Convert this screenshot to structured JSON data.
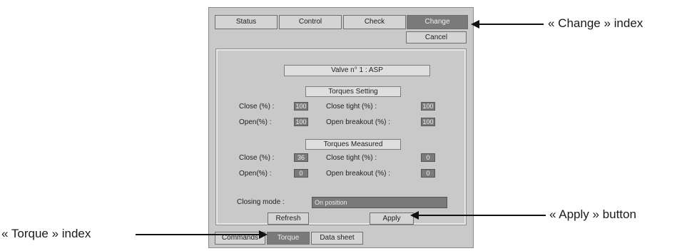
{
  "tabs": [
    {
      "label": "Status",
      "active": false
    },
    {
      "label": "Control",
      "active": false
    },
    {
      "label": "Check",
      "active": false
    },
    {
      "label": "Change",
      "active": true
    }
  ],
  "cancel_label": "Cancel",
  "valve_title": "Valve n° 1 : ASP",
  "torques_setting": {
    "title": "Torques Setting",
    "close_label": "Close (%) :",
    "close_value": "100",
    "close_tight_label": "Close tight (%) :",
    "close_tight_value": "100",
    "open_label": "Open(%) :",
    "open_value": "100",
    "open_breakout_label": "Open breakout (%) :",
    "open_breakout_value": "100"
  },
  "torques_measured": {
    "title": "Torques Measured",
    "close_label": "Close (%) :",
    "close_value": "36",
    "close_tight_label": "Close tight (%) :",
    "close_tight_value": "0",
    "open_label": "Open(%) :",
    "open_value": "0",
    "open_breakout_label": "Open breakout (%) :",
    "open_breakout_value": "0"
  },
  "closing_mode": {
    "label": "Closing mode :",
    "value": "On position"
  },
  "buttons": {
    "refresh": "Refresh",
    "apply": "Apply"
  },
  "bottom_tabs": [
    {
      "label": "Commands",
      "active": false
    },
    {
      "label": "Torque",
      "active": true
    },
    {
      "label": "Data sheet",
      "active": false
    }
  ],
  "annotations": {
    "change_index": "« Change » index",
    "apply_button": "« Apply » button",
    "torque_index": "« Torque » index"
  }
}
